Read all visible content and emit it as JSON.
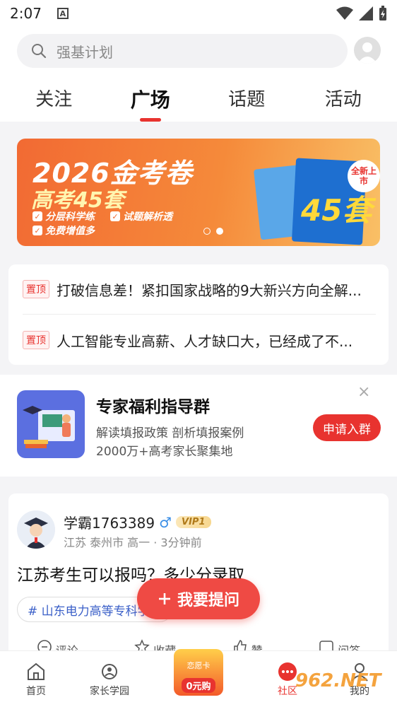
{
  "status": {
    "time": "2:07",
    "notif": "A"
  },
  "search": {
    "placeholder": "强基计划"
  },
  "tabs": [
    "关注",
    "广场",
    "话题",
    "活动"
  ],
  "banner": {
    "title": "2026金考卷",
    "subtitle": "高考45套",
    "tags": [
      "分层科学练",
      "试题解析透",
      "免费增值多"
    ],
    "book_number": "45套",
    "badge": "全新上市"
  },
  "pinned": {
    "tag": "置顶",
    "items": [
      "打破信息差！紧扣国家战略的9大新兴方向全解...",
      "人工智能专业高薪、人才缺口大，已经成了不..."
    ]
  },
  "promo": {
    "title": "专家福利指导群",
    "line1": "解读填报政策  剖析填报案例",
    "line2": "2000万+高考家长聚集地",
    "button": "申请入群",
    "close": "×"
  },
  "post": {
    "username": "学霸1763389",
    "gender": "♂",
    "vip": "VIP1",
    "meta": "江苏 泰州市 高一 · 3分钟前",
    "title": "江苏考生可以报吗？多少分录取",
    "topic": "# 山东电力高等专科学校",
    "actions": [
      "评论",
      "收藏",
      "赞",
      "问答"
    ]
  },
  "fab": {
    "label": "我要提问"
  },
  "tabbar": {
    "items": [
      "首页",
      "家长学园",
      "0元购",
      "社区",
      "我的"
    ],
    "promo_top": "恋愿卡"
  },
  "watermark": "962.NET",
  "colors": {
    "accent": "#e8332f",
    "banner": "#f26a33"
  }
}
